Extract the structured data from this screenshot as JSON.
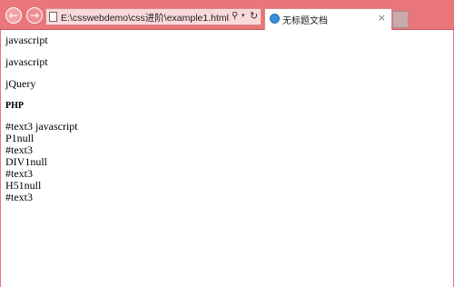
{
  "browser": {
    "address": "E:\\csswebdemo\\css进阶\\example1.html",
    "tab_title": "无标题文档",
    "back_glyph": "←",
    "forward_glyph": "→",
    "search_glyph": "⚲",
    "dropdown_glyph": "▾",
    "refresh_glyph": "↻",
    "close_glyph": "×",
    "accent_color": "#e9767a"
  },
  "page": {
    "para1": "javascript",
    "para2": "javascript",
    "para3": "jQuery",
    "heading": "PHP",
    "output_lines": [
      "#text3 javascript",
      "P1null",
      "#text3",
      "DIV1null",
      "#text3",
      "H51null",
      "#text3"
    ]
  }
}
